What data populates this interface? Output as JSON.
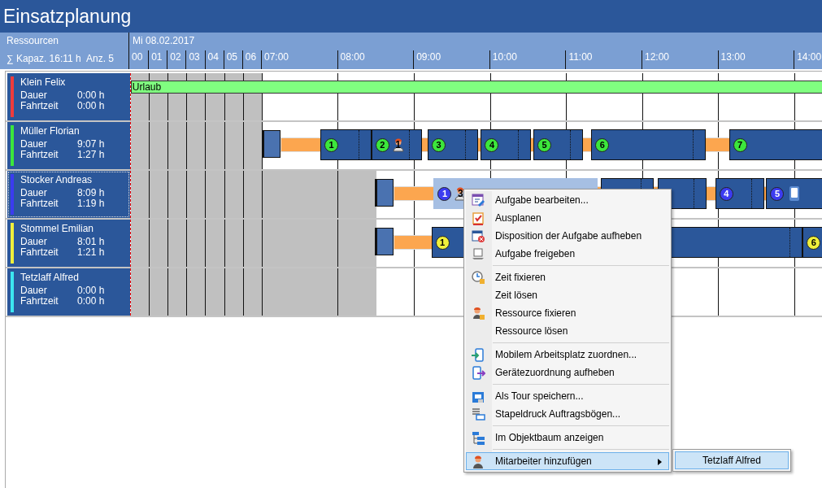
{
  "window": {
    "title": "Einsatzplanung"
  },
  "header": {
    "resources_label": "Ressourcen",
    "capacity": "∑ Kapaz. 16:11 h",
    "count": "Anz. 5",
    "date": "Mi 08.02.2017",
    "hours": [
      "00",
      "01",
      "02",
      "03",
      "04",
      "05",
      "06",
      "07:00",
      "08:00",
      "09:00",
      "10:00",
      "11:00",
      "12:00",
      "13:00",
      "14:00"
    ]
  },
  "resources": [
    {
      "name": "Klein Felix",
      "color": "#f03c3c",
      "selected": false,
      "duration_label": "Dauer",
      "duration": "0:00 h",
      "travel_label": "Fahrtzeit",
      "travel": "0:00 h",
      "absence": "Urlaub"
    },
    {
      "name": "Müller Florian",
      "color": "#3ce63c",
      "selected": false,
      "duration_label": "Dauer",
      "duration": "9:07 h",
      "travel_label": "Fahrtzeit",
      "travel": "1:27 h",
      "tasks": [
        {
          "number": "1",
          "selected": false
        },
        {
          "number": "2",
          "selected": false,
          "marker": {
            "kind": "worker",
            "number": "1"
          }
        },
        {
          "number": "3",
          "selected": false
        },
        {
          "number": "4",
          "selected": false
        },
        {
          "number": "5",
          "selected": false
        },
        {
          "number": "6",
          "selected": false
        },
        {
          "number": "7",
          "selected": false
        }
      ]
    },
    {
      "name": "Stocker Andreas",
      "color": "#3c3cf0",
      "selected": true,
      "duration_label": "Dauer",
      "duration": "8:09 h",
      "travel_label": "Fahrtzeit",
      "travel": "1:19 h",
      "tasks": [
        {
          "number": "1",
          "selected": true,
          "marker": {
            "kind": "worker",
            "number": "3"
          }
        },
        {
          "selected": false
        },
        {
          "selected": false
        },
        {
          "number": "4",
          "selected": false
        },
        {
          "number": "5",
          "selected": false,
          "marker": {
            "kind": "device"
          }
        }
      ]
    },
    {
      "name": "Stommel Emilian",
      "color": "#f0f03c",
      "selected": false,
      "duration_label": "Dauer",
      "duration": "8:01 h",
      "travel_label": "Fahrtzeit",
      "travel": "1:21 h",
      "tasks": [
        {
          "number": "1",
          "selected": false
        },
        {
          "number": "6",
          "selected": false
        }
      ]
    },
    {
      "name": "Tetzlaff Alfred",
      "color": "#3ce6f0",
      "selected": false,
      "duration_label": "Dauer",
      "duration": "0:00 h",
      "travel_label": "Fahrtzeit",
      "travel": "0:00 h"
    }
  ],
  "context_menu": {
    "groups": [
      [
        {
          "label": "Aufgabe bearbeiten...",
          "selected": false,
          "submenu": false
        },
        {
          "label": "Ausplanen",
          "selected": false,
          "submenu": false
        },
        {
          "label": "Disposition der Aufgabe aufheben",
          "selected": false,
          "submenu": false
        },
        {
          "label": "Aufgabe freigeben",
          "selected": false,
          "submenu": false
        }
      ],
      [
        {
          "label": "Zeit fixieren",
          "selected": false,
          "submenu": false
        },
        {
          "label": "Zeit lösen",
          "selected": false,
          "submenu": false
        },
        {
          "label": "Ressource fixieren",
          "selected": false,
          "submenu": false
        },
        {
          "label": "Ressource lösen",
          "selected": false,
          "submenu": false
        }
      ],
      [
        {
          "label": "Mobilem Arbeitsplatz zuordnen...",
          "selected": false,
          "submenu": false
        },
        {
          "label": "Gerätezuordnung aufheben",
          "selected": false,
          "submenu": false
        }
      ],
      [
        {
          "label": "Als Tour speichern...",
          "selected": false,
          "submenu": false
        },
        {
          "label": "Stapeldruck Auftragsbögen...",
          "selected": false,
          "submenu": false
        }
      ],
      [
        {
          "label": "Im Objektbaum anzeigen",
          "selected": false,
          "submenu": false
        }
      ],
      [
        {
          "label": "Mitarbeiter hinzufügen",
          "selected": true,
          "submenu": true
        }
      ]
    ]
  },
  "submenu": {
    "items": [
      {
        "label": "Tetzlaff Alfred",
        "selected": true
      }
    ]
  }
}
